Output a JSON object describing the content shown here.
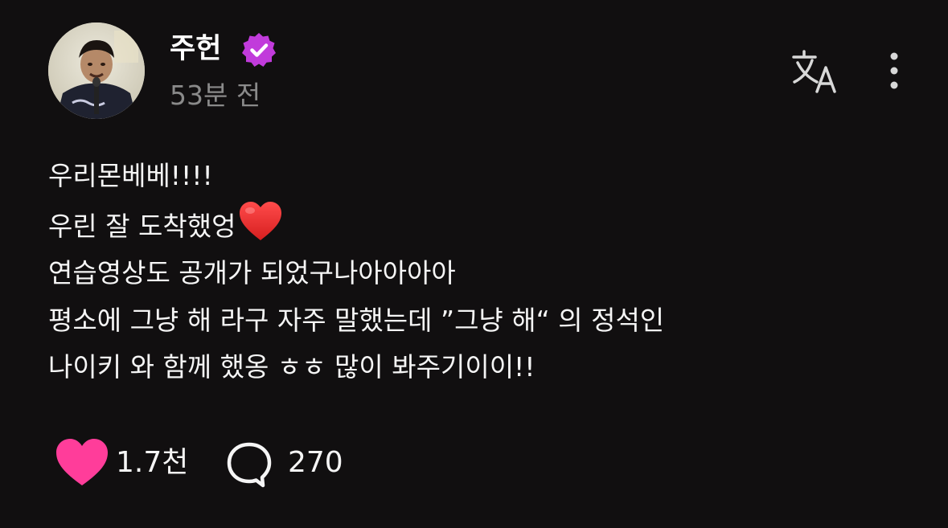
{
  "post": {
    "author": {
      "name": "주헌",
      "verified": true,
      "avatar_icon": "profile-photo"
    },
    "timestamp": "53분 전",
    "actions_top": {
      "translate_icon": "translate-icon",
      "more_icon": "more-vertical-icon"
    },
    "body_lines": [
      "우리몬베베!!!!",
      "우린 잘 도착했엉",
      "연습영상도 공개가 되었구나아아아아",
      "평소에 그냥 해 라구 자주 말했는데  ”그냥 해“ 의 정석인",
      "나이키 와 함께 했옹 ㅎㅎ 많이 봐주기이이!!"
    ],
    "emoji_after_line_2": "heart-emoji",
    "likes": {
      "count": "1.7천",
      "icon": "heart-icon",
      "liked": true
    },
    "comments": {
      "count": "270",
      "icon": "comment-icon"
    }
  },
  "colors": {
    "background": "#110f10",
    "verified_badge": "#c13bdb",
    "like_pink": "#ff3d9a",
    "muted_text": "#8a8a8a"
  }
}
